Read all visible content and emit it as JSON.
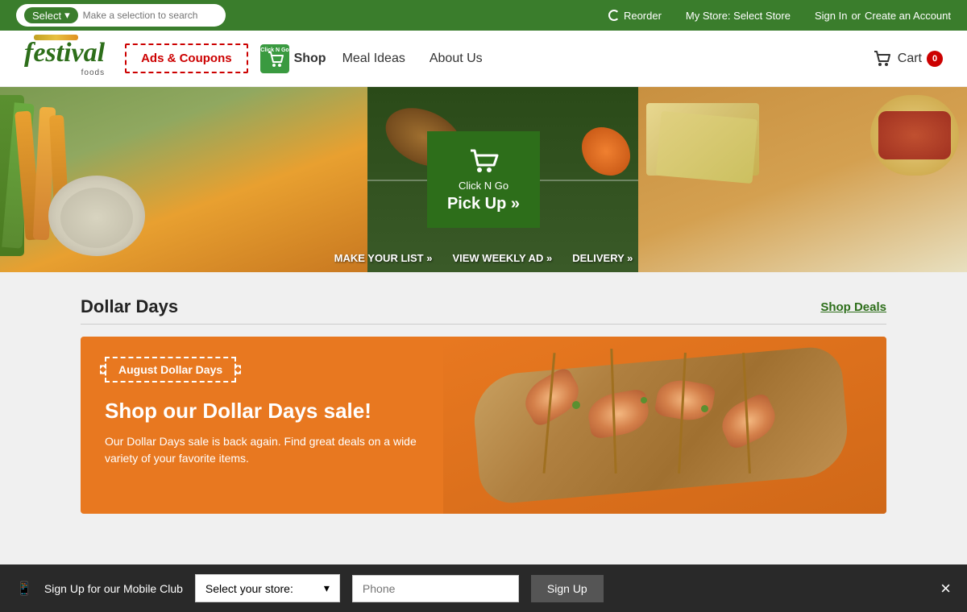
{
  "topbar": {
    "select_label": "Select",
    "search_placeholder": "Make a selection to search",
    "reorder_label": "Reorder",
    "my_store_label": "My Store: Select Store",
    "signin_label": "Sign In",
    "or_label": "or",
    "create_account_label": "Create an Account"
  },
  "nav": {
    "ads_coupons_label": "Ads & Coupons",
    "shop_label": "Shop",
    "meal_ideas_label": "Meal Ideas",
    "about_us_label": "About Us",
    "cart_label": "Cart",
    "cart_count": "0",
    "logo_name": "festival",
    "logo_sub": "foods"
  },
  "hero": {
    "clickngo_label": "Click N Go",
    "pickup_label": "Pick Up »",
    "make_list_label": "MAKE YOUR LIST »",
    "view_weekly_label": "VIEW WEEKLY AD »",
    "delivery_label": "DELIVERY »"
  },
  "dollar_days": {
    "section_title": "Dollar Days",
    "shop_deals_label": "Shop Deals",
    "badge_label": "August Dollar Days",
    "banner_heading": "Shop our Dollar Days sale!",
    "banner_text": "Our Dollar Days sale is back again. Find great deals on a wide variety of your favorite items."
  },
  "mobile_signup": {
    "icon": "📱",
    "label": "Sign Up for our Mobile Club",
    "store_placeholder": "Select your store:",
    "phone_placeholder": "Phone",
    "signup_btn": "Sign Up",
    "close_label": "×"
  }
}
